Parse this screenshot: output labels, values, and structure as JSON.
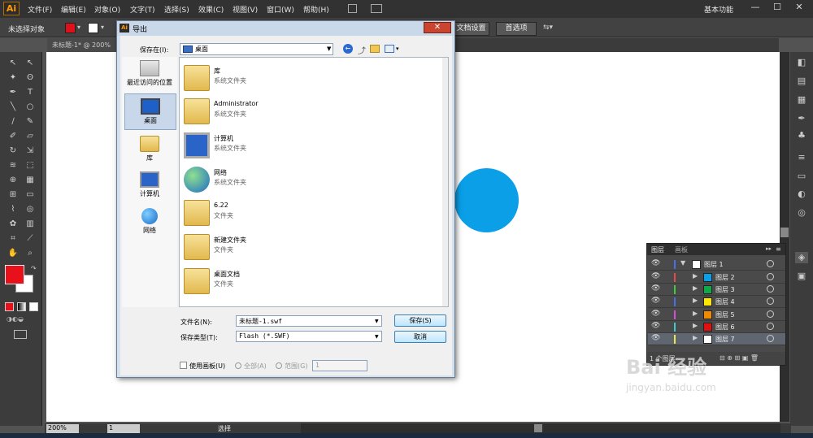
{
  "app": {
    "logo": "Ai",
    "menu": [
      "文件(F)",
      "编辑(E)",
      "对象(O)",
      "文字(T)",
      "选择(S)",
      "效果(C)",
      "视图(V)",
      "窗口(W)",
      "帮助(H)"
    ],
    "workspace": "基本功能",
    "win_min": "—",
    "win_max": "☐",
    "win_close": "✕"
  },
  "control": {
    "no_selection": "未选择对象",
    "doc_setup": "文档设置",
    "prefs": "首选项",
    "fill_color": "#e0101a"
  },
  "document": {
    "tab": "未标题-1* @ 200%"
  },
  "canvas": {
    "circle_color": "#0b9fe8"
  },
  "status": {
    "zoom": "200%",
    "page": "1",
    "tool": "选择"
  },
  "layers": {
    "tab1": "图层",
    "tab2": "画板",
    "count": "1 个图层",
    "rows": [
      {
        "name": "图层 1",
        "color": "#4a6de8",
        "thumb": "#ffffff"
      },
      {
        "name": "图层 2",
        "color": "#e84a4a",
        "thumb": "#0b9fe8"
      },
      {
        "name": "图层 3",
        "color": "#3ccc3c",
        "thumb": "#11a84a"
      },
      {
        "name": "图层 4",
        "color": "#4a6de8",
        "thumb": "#ffe800"
      },
      {
        "name": "图层 5",
        "color": "#d84ad8",
        "thumb": "#f08a00"
      },
      {
        "name": "图层 6",
        "color": "#3ccccc",
        "thumb": "#e01010"
      },
      {
        "name": "图层 7",
        "color": "#e8e84a",
        "thumb": "#ffffff"
      }
    ]
  },
  "dialog": {
    "title": "导出",
    "close": "✕",
    "save_in_label": "保存在(I):",
    "location": "桌面",
    "places": [
      "最近访问的位置",
      "桌面",
      "库",
      "计算机",
      "网络"
    ],
    "files": [
      {
        "name": "库",
        "desc": "系统文件夹"
      },
      {
        "name": "Administrator",
        "desc": "系统文件夹"
      },
      {
        "name": "计算机",
        "desc": "系统文件夹"
      },
      {
        "name": "网络",
        "desc": "系统文件夹"
      },
      {
        "name": "6.22",
        "desc": "文件夹"
      },
      {
        "name": "新建文件夹",
        "desc": "文件夹"
      },
      {
        "name": "桌面文档",
        "desc": "文件夹"
      }
    ],
    "filename_label": "文件名(N):",
    "filename": "未标题-1.swf",
    "filetype_label": "保存类型(T):",
    "filetype": "Flash (*.SWF)",
    "save_btn": "保存(S)",
    "cancel_btn": "取消",
    "use_artboard": "使用画板(U)",
    "all": "全部(A)",
    "range": "范围(G)",
    "range_value": "1"
  },
  "watermark": {
    "brand": "Bai 经验",
    "url": "jingyan.baidu.com"
  }
}
